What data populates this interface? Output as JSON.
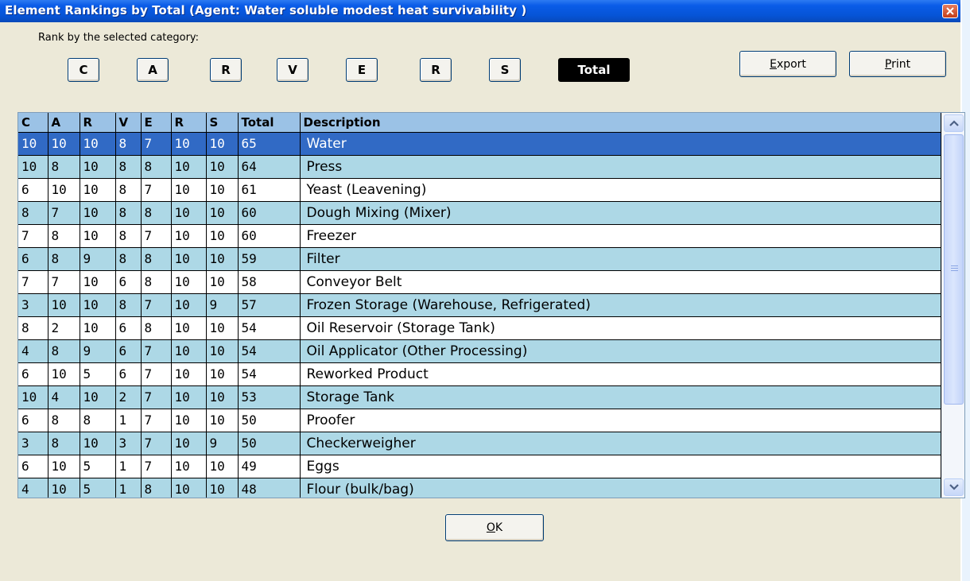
{
  "window": {
    "title": "Element Rankings by Total (Agent: Water soluble modest heat survivability  )"
  },
  "rank_label": "Rank by the selected category:",
  "category_buttons": [
    {
      "label": "C",
      "selected": false
    },
    {
      "label": "A",
      "selected": false
    },
    {
      "label": "R",
      "selected": false
    },
    {
      "label": "V",
      "selected": false
    },
    {
      "label": "E",
      "selected": false
    },
    {
      "label": "R",
      "selected": false
    },
    {
      "label": "S",
      "selected": false
    },
    {
      "label": "Total",
      "selected": true
    }
  ],
  "actions": {
    "export_mnemonic": "E",
    "export_rest": "xport",
    "print_mnemonic": "P",
    "print_rest": "rint",
    "ok_mnemonic": "O",
    "ok_rest": "K"
  },
  "table": {
    "headers": [
      "C",
      "A",
      "R",
      "V",
      "E",
      "R",
      "S",
      "Total",
      "Description"
    ],
    "rows": [
      [
        "10",
        "10",
        "10",
        "8",
        "7",
        "10",
        "10",
        "65",
        "Water"
      ],
      [
        "10",
        "8",
        "10",
        "8",
        "8",
        "10",
        "10",
        "64",
        "Press"
      ],
      [
        "6",
        "10",
        "10",
        "8",
        "7",
        "10",
        "10",
        "61",
        "Yeast (Leavening)"
      ],
      [
        "8",
        "7",
        "10",
        "8",
        "8",
        "10",
        "10",
        "60",
        "Dough Mixing (Mixer)"
      ],
      [
        "7",
        "8",
        "10",
        "8",
        "7",
        "10",
        "10",
        "60",
        "Freezer"
      ],
      [
        "6",
        "8",
        "9",
        "8",
        "8",
        "10",
        "10",
        "59",
        "Filter"
      ],
      [
        "7",
        "7",
        "10",
        "6",
        "8",
        "10",
        "10",
        "58",
        "Conveyor Belt"
      ],
      [
        "3",
        "10",
        "10",
        "8",
        "7",
        "10",
        "9",
        "57",
        "Frozen Storage (Warehouse, Refrigerated)"
      ],
      [
        "8",
        "2",
        "10",
        "6",
        "8",
        "10",
        "10",
        "54",
        "Oil Reservoir (Storage Tank)"
      ],
      [
        "4",
        "8",
        "9",
        "6",
        "7",
        "10",
        "10",
        "54",
        "Oil Applicator (Other Processing)"
      ],
      [
        "6",
        "10",
        "5",
        "6",
        "7",
        "10",
        "10",
        "54",
        "Reworked Product"
      ],
      [
        "10",
        "4",
        "10",
        "2",
        "7",
        "10",
        "10",
        "53",
        "Storage Tank"
      ],
      [
        "6",
        "8",
        "8",
        "1",
        "7",
        "10",
        "10",
        "50",
        "Proofer"
      ],
      [
        "3",
        "8",
        "10",
        "3",
        "7",
        "10",
        "9",
        "50",
        "Checkerweigher"
      ],
      [
        "6",
        "10",
        "5",
        "1",
        "7",
        "10",
        "10",
        "49",
        "Eggs"
      ],
      [
        "4",
        "10",
        "5",
        "1",
        "8",
        "10",
        "10",
        "48",
        "Flour (bulk/bag)"
      ]
    ],
    "selected_row": 0
  },
  "colors": {
    "title_bar": "#0654d6",
    "header_bg": "#9bc2e6",
    "row_alt": "#add8e6",
    "row_selected": "#316ac5",
    "dialog_bg": "#ece9d8"
  },
  "icons": {
    "close": "close-icon",
    "scroll_up": "chevron-up-icon",
    "scroll_down": "chevron-down-icon"
  }
}
